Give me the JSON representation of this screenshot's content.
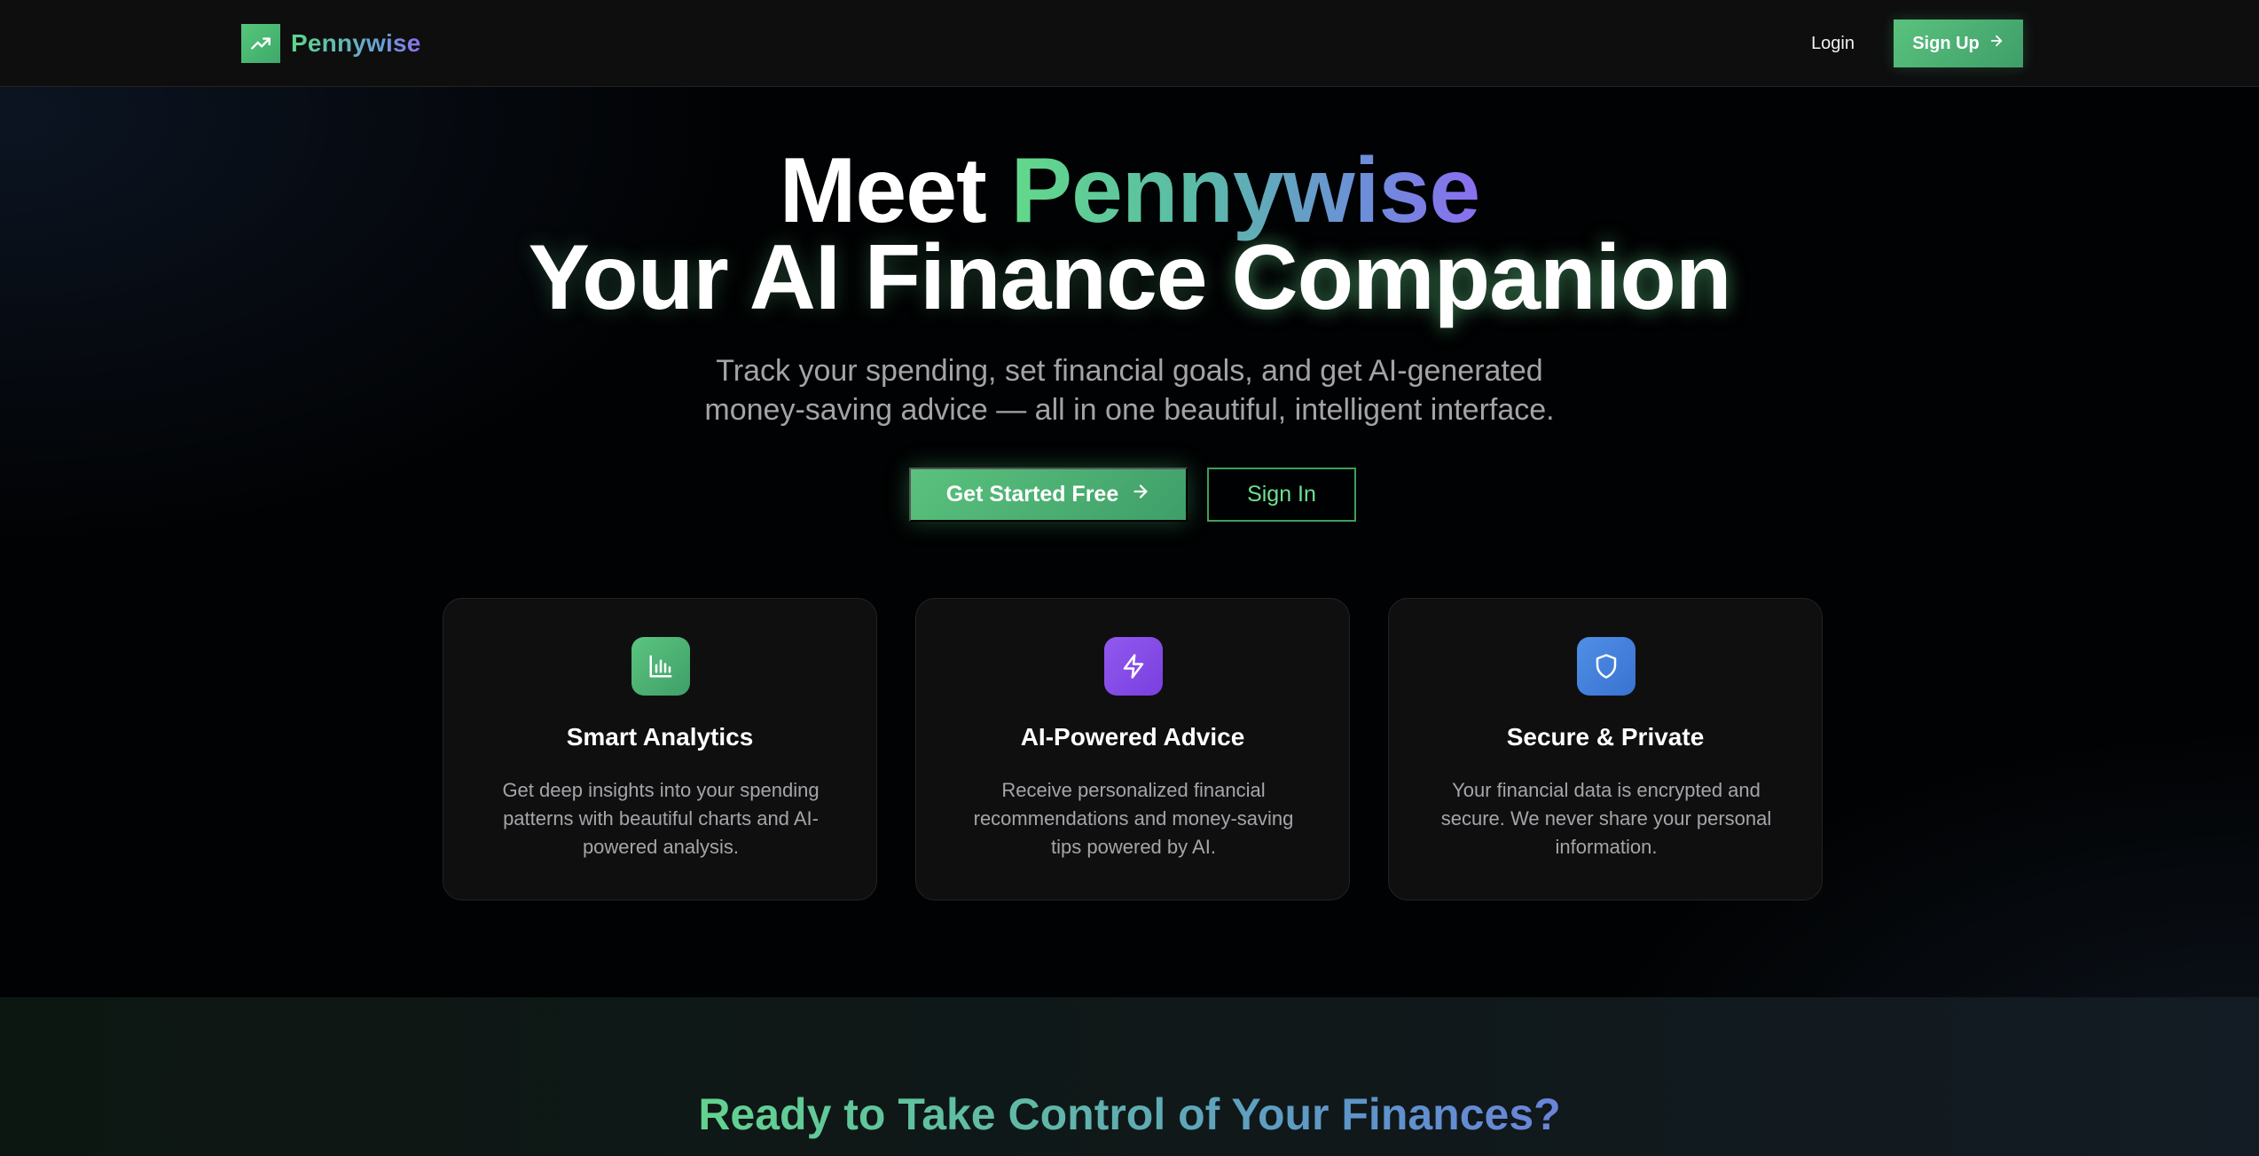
{
  "nav": {
    "brand": "Pennywise",
    "login_label": "Login",
    "signup_label": "Sign Up"
  },
  "hero": {
    "title_line1_prefix": "Meet",
    "title_line1_brand": "Pennywise",
    "title_line2_prefix": "Your AI Finance",
    "title_line2_highlight": "Companion",
    "subtitle_line1": "Track your spending, set financial goals, and get AI-generated",
    "subtitle_line2": "money-saving advice — all in one beautiful, intelligent interface.",
    "primary_cta": "Get Started Free",
    "secondary_cta": "Sign In"
  },
  "features": [
    {
      "icon": "bar-chart-icon",
      "title": "Smart Analytics",
      "description": "Get deep insights into your spending patterns with beautiful charts and AI-powered analysis."
    },
    {
      "icon": "lightning-icon",
      "title": "AI-Powered Advice",
      "description": "Receive personalized financial recommendations and money-saving tips powered by AI."
    },
    {
      "icon": "shield-icon",
      "title": "Secure & Private",
      "description": "Your financial data is encrypted and secure. We never share your personal information."
    }
  ],
  "bottom": {
    "title": "Ready to Take Control of Your Finances?"
  },
  "colors": {
    "accent_green": "#5ac27d",
    "accent_purple": "#8a4fe8",
    "accent_blue": "#4a86e0",
    "background": "#010203"
  }
}
